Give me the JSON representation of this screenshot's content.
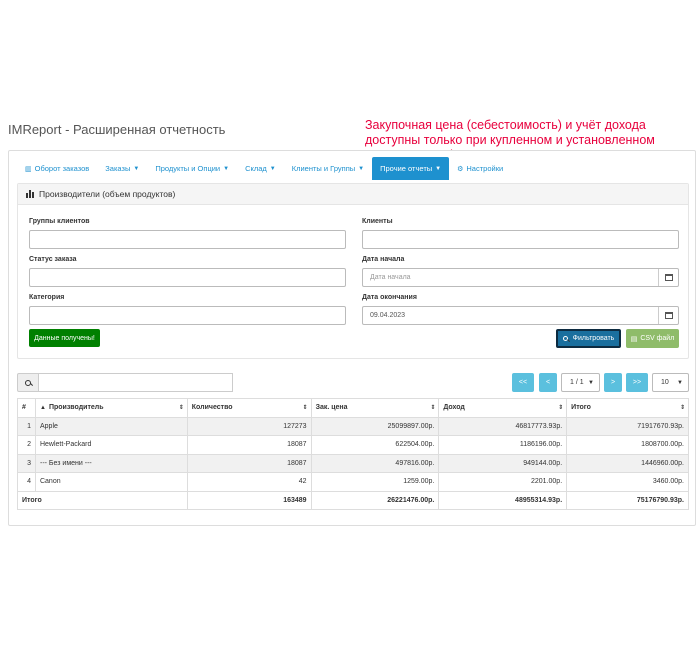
{
  "page": {
    "title": "IMReport - Расширенная отчетность",
    "notice": "Закупочная цена (себестоимость) и учёт дохода доступны только при купленном и установленном модуле IMStock"
  },
  "nav": {
    "items": [
      {
        "label": "Оборот заказов",
        "icon": "bar-chart-icon",
        "dropdown": false
      },
      {
        "label": "Заказы",
        "dropdown": true
      },
      {
        "label": "Продукты и Опции",
        "dropdown": true
      },
      {
        "label": "Склад",
        "dropdown": true
      },
      {
        "label": "Клиенты и Группы",
        "dropdown": true
      },
      {
        "label": "Прочие отчеты",
        "dropdown": true,
        "active": true
      },
      {
        "label": "Настройки",
        "icon": "gears-icon",
        "dropdown": false
      }
    ]
  },
  "report": {
    "title": "Производители (объем продуктов)",
    "filters": {
      "customer_groups_label": "Группы клиентов",
      "customer_groups_value": "",
      "customers_label": "Клиенты",
      "customers_value": "",
      "order_status_label": "Статус заказа",
      "order_status_value": "",
      "date_start_label": "Дата начала",
      "date_start_placeholder": "Дата начала",
      "category_label": "Категория",
      "category_value": "",
      "date_end_label": "Дата окончания",
      "date_end_value": "09.04.2023"
    },
    "buttons": {
      "data_received": "Данные получены!",
      "filter": "Фильтровать",
      "csv": "CSV файл"
    }
  },
  "pagination": {
    "first": "<<",
    "prev": "<",
    "page": "1 / 1",
    "next": ">",
    "last": ">>",
    "per_page": "10"
  },
  "table": {
    "headers": [
      "#",
      "Производитель",
      "Количество",
      "Зак. цена",
      "Доход",
      "Итого"
    ],
    "rows": [
      [
        "1",
        "Apple",
        "127273",
        "25099897.00р.",
        "46817773.93р.",
        "71917670.93р."
      ],
      [
        "2",
        "Hewlett-Packard",
        "18087",
        "622504.00р.",
        "1186196.00р.",
        "1808700.00р."
      ],
      [
        "3",
        "--- Без имени ---",
        "18087",
        "497816.00р.",
        "949144.00р.",
        "1446960.00р."
      ],
      [
        "4",
        "Canon",
        "42",
        "1259.00р.",
        "2201.00р.",
        "3460.00р."
      ]
    ],
    "footer": [
      "Итого",
      "163489",
      "26221476.00р.",
      "48955314.93р.",
      "75176790.93р."
    ]
  },
  "colors": {
    "accent": "#1e91cf",
    "notice": "#e8003d",
    "success": "#008000",
    "info": "#5bc0de",
    "csv": "#8fbc6a"
  }
}
